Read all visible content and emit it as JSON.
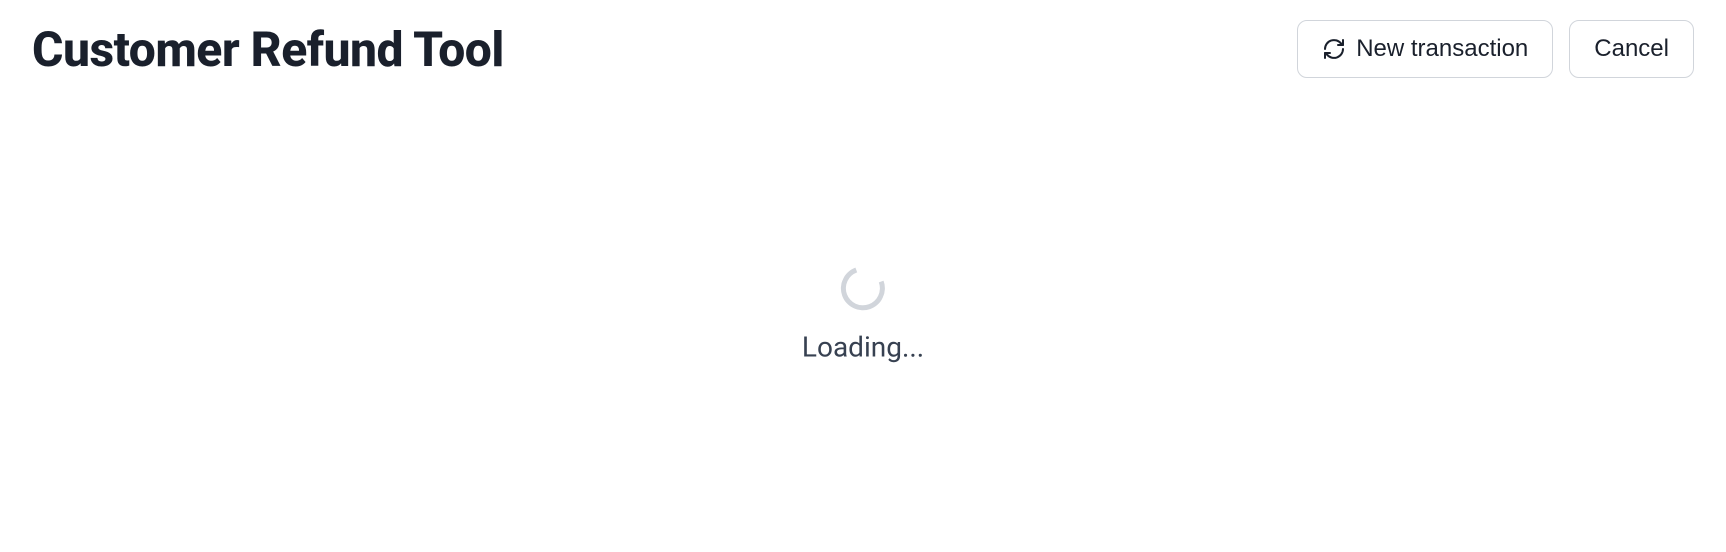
{
  "header": {
    "title": "Customer Refund Tool",
    "buttons": {
      "new_transaction": "New transaction",
      "cancel": "Cancel"
    }
  },
  "main": {
    "loading_text": "Loading..."
  }
}
